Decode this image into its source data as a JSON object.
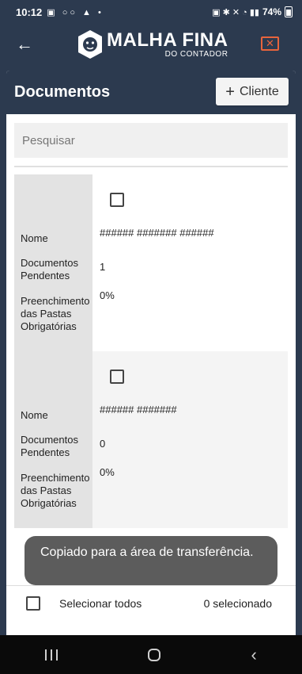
{
  "status": {
    "time": "10:12",
    "battery": "74%",
    "left_icons": "▣ ○○ ▲ •",
    "right_icons": "▣ ✱ ✕ ◔ ▮▮"
  },
  "appbar": {
    "logo_main": "MALHA FINA",
    "logo_sub": "DO CONTADOR",
    "back_icon": "←",
    "close_icon": "✕"
  },
  "card": {
    "title": "Documentos",
    "client_button_label": "Cliente",
    "client_button_icon": "+",
    "search_placeholder": "Pesquisar"
  },
  "rows": [
    {
      "nome_label": "Nome",
      "nome_value": "###### ####### ######",
      "pendentes_label": "Documentos Pendentes",
      "pendentes_value": "1",
      "preenchimento_label": "Preenchimento das Pastas Obrigatórias",
      "preenchimento_value": "0%"
    },
    {
      "nome_label": "Nome",
      "nome_value": "###### #######",
      "pendentes_label": "Documentos Pendentes",
      "pendentes_value": "0",
      "preenchimento_label": "Preenchimento das Pastas Obrigatórias",
      "preenchimento_value": "0%"
    }
  ],
  "toast": {
    "message": "Copiado para a área de transferência."
  },
  "footer": {
    "select_all_label": "Selecionar todos",
    "selected_count": "0 selecionado"
  },
  "colors": {
    "header": "#2c3a4f",
    "accent": "#e8643c"
  }
}
